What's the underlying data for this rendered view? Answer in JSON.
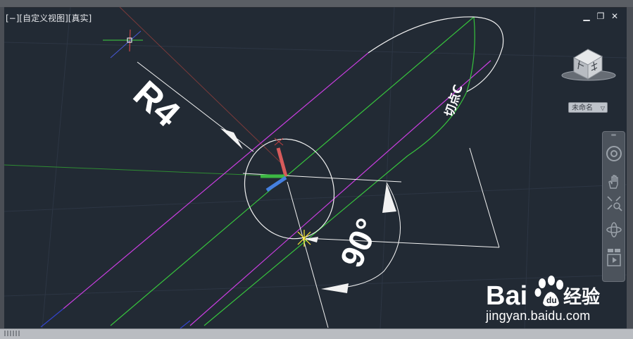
{
  "viewport": {
    "view_label": "[−][自定义视图][真实]",
    "colors": {
      "background": "#222a34",
      "magenta": "#c93ee0",
      "green": "#37c43d",
      "white": "#f2f2f2"
    }
  },
  "window_controls": {
    "minimize": "▁",
    "restore": "❐",
    "close": "✕"
  },
  "viewcube": {
    "icon": "viewcube-icon"
  },
  "ucs_selector": {
    "label": "未命名",
    "dropdown_icon": "chevron-down-icon"
  },
  "nav_bar": {
    "tools": [
      {
        "icon": "steering-wheel-icon"
      },
      {
        "icon": "pan-hand-icon"
      },
      {
        "icon": "zoom-extents-icon"
      },
      {
        "icon": "orbit-icon"
      },
      {
        "icon": "showmotion-icon"
      }
    ]
  },
  "drawing": {
    "radius_label": "R4",
    "tangent_label": "切点C",
    "angle_label": "90°"
  },
  "watermark": {
    "brand": "Bai",
    "brand_suffix": "经验",
    "url": "jingyan.baidu.com"
  }
}
